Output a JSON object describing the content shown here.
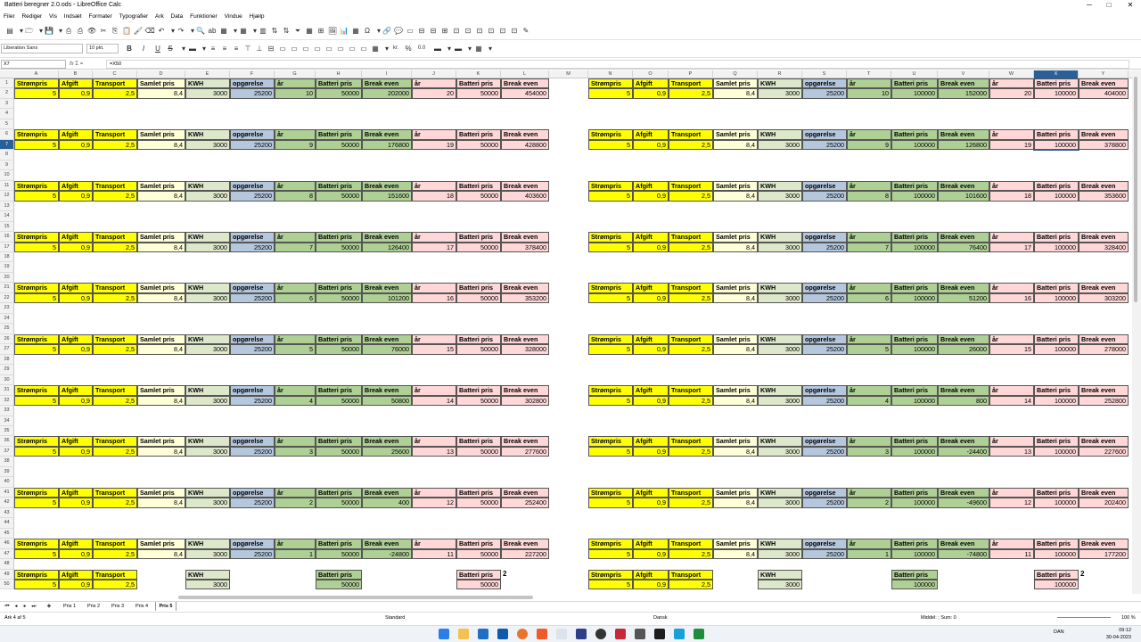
{
  "window": {
    "title": "Batteri beregner 2.0.ods - LibreOffice Calc",
    "min_glyph": "─",
    "max_glyph": "□",
    "close_glyph": "✕"
  },
  "menu": [
    "Filer",
    "Rediger",
    "Vis",
    "Indsæt",
    "Formater",
    "Typografier",
    "Ark",
    "Data",
    "Funktioner",
    "Vindue",
    "Hjælp"
  ],
  "toolbar": {
    "font_name": "Liberation Sans",
    "font_size": "10 pkt.",
    "bold": "B",
    "italic": "I",
    "underline": "U",
    "strike": "S",
    "currency": "kr.",
    "percent": "%",
    "decimal_places": "0.0"
  },
  "formula_bar": {
    "cell_ref": "X7",
    "fx": "fx",
    "sum": "Σ",
    "eq": "=",
    "content": "=X50"
  },
  "colors": {
    "yellow": "#ffff00",
    "light_yellow": "#ffffd7",
    "light_green": "#dde8cb",
    "blue": "#b4c7dc",
    "green": "#afd095",
    "pink": "#ffd7d7",
    "selection": "#2a6099",
    "row_header": "#f2f2f2"
  },
  "columns": [
    "A",
    "B",
    "C",
    "D",
    "E",
    "F",
    "G",
    "H",
    "I",
    "J",
    "K",
    "L",
    "M",
    "N",
    "O",
    "P",
    "Q",
    "R",
    "S",
    "T",
    "U",
    "V",
    "W",
    "X",
    "Y"
  ],
  "active_col": "X",
  "active_row": 7,
  "headers": [
    "Strømpris",
    "Afgift",
    "Transport",
    "Samlet pris",
    "KWH",
    "opgørelse",
    "år",
    "Batteri pris",
    "Break even",
    "år",
    "Batteri pris",
    "Break even"
  ],
  "blocks": [
    {
      "row": 1,
      "left": [
        "5",
        "0,9",
        "2,5",
        "8,4",
        "3000",
        "25200",
        "10",
        "50000",
        "202000",
        "20",
        "50000",
        "454000"
      ],
      "right": [
        "5",
        "0,9",
        "2,5",
        "8,4",
        "3000",
        "25200",
        "10",
        "100000",
        "152000",
        "20",
        "100000",
        "404000"
      ]
    },
    {
      "row": 6,
      "left": [
        "5",
        "0,9",
        "2,5",
        "8,4",
        "3000",
        "25200",
        "9",
        "50000",
        "176800",
        "19",
        "50000",
        "428800"
      ],
      "right": [
        "5",
        "0,9",
        "2,5",
        "8,4",
        "3000",
        "25200",
        "9",
        "100000",
        "126800",
        "19",
        "100000",
        "378800"
      ]
    },
    {
      "row": 11,
      "left": [
        "5",
        "0,9",
        "2,5",
        "8,4",
        "3000",
        "25200",
        "8",
        "50000",
        "151600",
        "18",
        "50000",
        "403600"
      ],
      "right": [
        "5",
        "0,9",
        "2,5",
        "8,4",
        "3000",
        "25200",
        "8",
        "100000",
        "101600",
        "18",
        "100000",
        "353600"
      ]
    },
    {
      "row": 16,
      "left": [
        "5",
        "0,9",
        "2,5",
        "8,4",
        "3000",
        "25200",
        "7",
        "50000",
        "126400",
        "17",
        "50000",
        "378400"
      ],
      "right": [
        "5",
        "0,9",
        "2,5",
        "8,4",
        "3000",
        "25200",
        "7",
        "100000",
        "76400",
        "17",
        "100000",
        "328400"
      ]
    },
    {
      "row": 21,
      "left": [
        "5",
        "0,9",
        "2,5",
        "8,4",
        "3000",
        "25200",
        "6",
        "50000",
        "101200",
        "16",
        "50000",
        "353200"
      ],
      "right": [
        "5",
        "0,9",
        "2,5",
        "8,4",
        "3000",
        "25200",
        "6",
        "100000",
        "51200",
        "16",
        "100000",
        "303200"
      ]
    },
    {
      "row": 26,
      "left": [
        "5",
        "0,9",
        "2,5",
        "8,4",
        "3000",
        "25200",
        "5",
        "50000",
        "76000",
        "15",
        "50000",
        "328000"
      ],
      "right": [
        "5",
        "0,9",
        "2,5",
        "8,4",
        "3000",
        "25200",
        "5",
        "100000",
        "26000",
        "15",
        "100000",
        "278000"
      ]
    },
    {
      "row": 31,
      "left": [
        "5",
        "0,9",
        "2,5",
        "8,4",
        "3000",
        "25200",
        "4",
        "50000",
        "50800",
        "14",
        "50000",
        "302800"
      ],
      "right": [
        "5",
        "0,9",
        "2,5",
        "8,4",
        "3000",
        "25200",
        "4",
        "100000",
        "800",
        "14",
        "100000",
        "252800"
      ]
    },
    {
      "row": 36,
      "left": [
        "5",
        "0,9",
        "2,5",
        "8,4",
        "3000",
        "25200",
        "3",
        "50000",
        "25600",
        "13",
        "50000",
        "277600"
      ],
      "right": [
        "5",
        "0,9",
        "2,5",
        "8,4",
        "3000",
        "25200",
        "3",
        "100000",
        "-24400",
        "13",
        "100000",
        "227600"
      ]
    },
    {
      "row": 41,
      "left": [
        "5",
        "0,9",
        "2,5",
        "8,4",
        "3000",
        "25200",
        "2",
        "50000",
        "400",
        "12",
        "50000",
        "252400"
      ],
      "right": [
        "5",
        "0,9",
        "2,5",
        "8,4",
        "3000",
        "25200",
        "2",
        "100000",
        "-49600",
        "12",
        "100000",
        "202400"
      ]
    },
    {
      "row": 46,
      "left": [
        "5",
        "0,9",
        "2,5",
        "8,4",
        "3000",
        "25200",
        "1",
        "50000",
        "-24800",
        "11",
        "50000",
        "227200"
      ],
      "right": [
        "5",
        "0,9",
        "2,5",
        "8,4",
        "3000",
        "25200",
        "1",
        "100000",
        "-74800",
        "11",
        "100000",
        "177200"
      ]
    }
  ],
  "bottom_block": {
    "row": 49,
    "left_vals": [
      "5",
      "0,9",
      "2,5",
      "3000",
      "50000",
      "50000"
    ],
    "right_vals": [
      "5",
      "0,9",
      "2,5",
      "3000",
      "100000",
      "100000"
    ],
    "extra": "2"
  },
  "sheet_tabs": [
    "Pris 1",
    "Pris 2",
    "Pris 3",
    "Pris 4",
    "Pris 5"
  ],
  "active_sheet": "Pris 5",
  "status": {
    "sheet": "Ark 4 af 5",
    "style": "Standard",
    "language": "Dansk",
    "summary": "Middel: ; Sum: 0",
    "zoom": "100 %"
  },
  "taskbar": {
    "lang": "DAN",
    "time": "09:12",
    "date": "30-04-2023"
  }
}
